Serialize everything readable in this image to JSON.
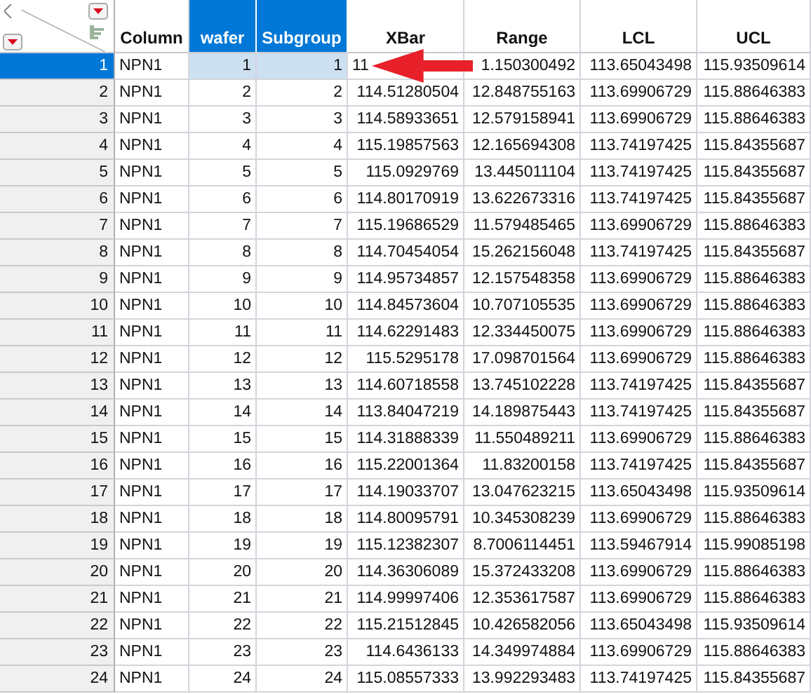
{
  "columns": [
    {
      "label": "Column",
      "selected": false
    },
    {
      "label": "wafer",
      "selected": true
    },
    {
      "label": "Subgroup",
      "selected": true
    },
    {
      "label": "XBar",
      "selected": false
    },
    {
      "label": "Range",
      "selected": false
    },
    {
      "label": "LCL",
      "selected": false
    },
    {
      "label": "UCL",
      "selected": false
    }
  ],
  "rows": [
    {
      "n": "1",
      "selected": true,
      "covered": true,
      "cells": [
        "NPN1",
        "1",
        "1",
        "11",
        "1.150300492",
        "113.65043498",
        "115.93509614"
      ]
    },
    {
      "n": "2",
      "selected": false,
      "covered": false,
      "cells": [
        "NPN1",
        "2",
        "2",
        "114.51280504",
        "12.848755163",
        "113.69906729",
        "115.88646383"
      ]
    },
    {
      "n": "3",
      "selected": false,
      "covered": false,
      "cells": [
        "NPN1",
        "3",
        "3",
        "114.58933651",
        "12.579158941",
        "113.69906729",
        "115.88646383"
      ]
    },
    {
      "n": "4",
      "selected": false,
      "covered": false,
      "cells": [
        "NPN1",
        "4",
        "4",
        "115.19857563",
        "12.165694308",
        "113.74197425",
        "115.84355687"
      ]
    },
    {
      "n": "5",
      "selected": false,
      "covered": false,
      "cells": [
        "NPN1",
        "5",
        "5",
        "115.0929769",
        "13.445011104",
        "113.74197425",
        "115.84355687"
      ]
    },
    {
      "n": "6",
      "selected": false,
      "covered": false,
      "cells": [
        "NPN1",
        "6",
        "6",
        "114.80170919",
        "13.622673316",
        "113.74197425",
        "115.84355687"
      ]
    },
    {
      "n": "7",
      "selected": false,
      "covered": false,
      "cells": [
        "NPN1",
        "7",
        "7",
        "115.19686529",
        "11.579485465",
        "113.69906729",
        "115.88646383"
      ]
    },
    {
      "n": "8",
      "selected": false,
      "covered": false,
      "cells": [
        "NPN1",
        "8",
        "8",
        "114.70454054",
        "15.262156048",
        "113.74197425",
        "115.84355687"
      ]
    },
    {
      "n": "9",
      "selected": false,
      "covered": false,
      "cells": [
        "NPN1",
        "9",
        "9",
        "114.95734857",
        "12.157548358",
        "113.69906729",
        "115.88646383"
      ]
    },
    {
      "n": "10",
      "selected": false,
      "covered": false,
      "cells": [
        "NPN1",
        "10",
        "10",
        "114.84573604",
        "10.707105535",
        "113.69906729",
        "115.88646383"
      ]
    },
    {
      "n": "11",
      "selected": false,
      "covered": false,
      "cells": [
        "NPN1",
        "11",
        "11",
        "114.62291483",
        "12.334450075",
        "113.69906729",
        "115.88646383"
      ]
    },
    {
      "n": "12",
      "selected": false,
      "covered": false,
      "cells": [
        "NPN1",
        "12",
        "12",
        "115.5295178",
        "17.098701564",
        "113.69906729",
        "115.88646383"
      ]
    },
    {
      "n": "13",
      "selected": false,
      "covered": false,
      "cells": [
        "NPN1",
        "13",
        "13",
        "114.60718558",
        "13.745102228",
        "113.74197425",
        "115.84355687"
      ]
    },
    {
      "n": "14",
      "selected": false,
      "covered": false,
      "cells": [
        "NPN1",
        "14",
        "14",
        "113.84047219",
        "14.189875443",
        "113.74197425",
        "115.84355687"
      ]
    },
    {
      "n": "15",
      "selected": false,
      "covered": false,
      "cells": [
        "NPN1",
        "15",
        "15",
        "114.31888339",
        "11.550489211",
        "113.69906729",
        "115.88646383"
      ]
    },
    {
      "n": "16",
      "selected": false,
      "covered": false,
      "cells": [
        "NPN1",
        "16",
        "16",
        "115.22001364",
        "11.83200158",
        "113.74197425",
        "115.84355687"
      ]
    },
    {
      "n": "17",
      "selected": false,
      "covered": false,
      "cells": [
        "NPN1",
        "17",
        "17",
        "114.19033707",
        "13.047623215",
        "113.65043498",
        "115.93509614"
      ]
    },
    {
      "n": "18",
      "selected": false,
      "covered": false,
      "cells": [
        "NPN1",
        "18",
        "18",
        "114.80095791",
        "10.345308239",
        "113.69906729",
        "115.88646383"
      ]
    },
    {
      "n": "19",
      "selected": false,
      "covered": false,
      "cells": [
        "NPN1",
        "19",
        "19",
        "115.12382307",
        "8.7006114451",
        "113.59467914",
        "115.99085198"
      ]
    },
    {
      "n": "20",
      "selected": false,
      "covered": false,
      "cells": [
        "NPN1",
        "20",
        "20",
        "114.36306089",
        "15.372433208",
        "113.69906729",
        "115.88646383"
      ]
    },
    {
      "n": "21",
      "selected": false,
      "covered": false,
      "cells": [
        "NPN1",
        "21",
        "21",
        "114.99997406",
        "12.353617587",
        "113.69906729",
        "115.88646383"
      ]
    },
    {
      "n": "22",
      "selected": false,
      "covered": false,
      "cells": [
        "NPN1",
        "22",
        "22",
        "115.21512845",
        "10.426582056",
        "113.65043498",
        "115.93509614"
      ]
    },
    {
      "n": "23",
      "selected": false,
      "covered": false,
      "cells": [
        "NPN1",
        "23",
        "23",
        "114.6436133",
        "14.349974884",
        "113.69906729",
        "115.88646383"
      ]
    },
    {
      "n": "24",
      "selected": false,
      "covered": false,
      "cells": [
        "NPN1",
        "24",
        "24",
        "115.08557333",
        "13.992293483",
        "113.74197425",
        "115.84355687"
      ]
    }
  ]
}
